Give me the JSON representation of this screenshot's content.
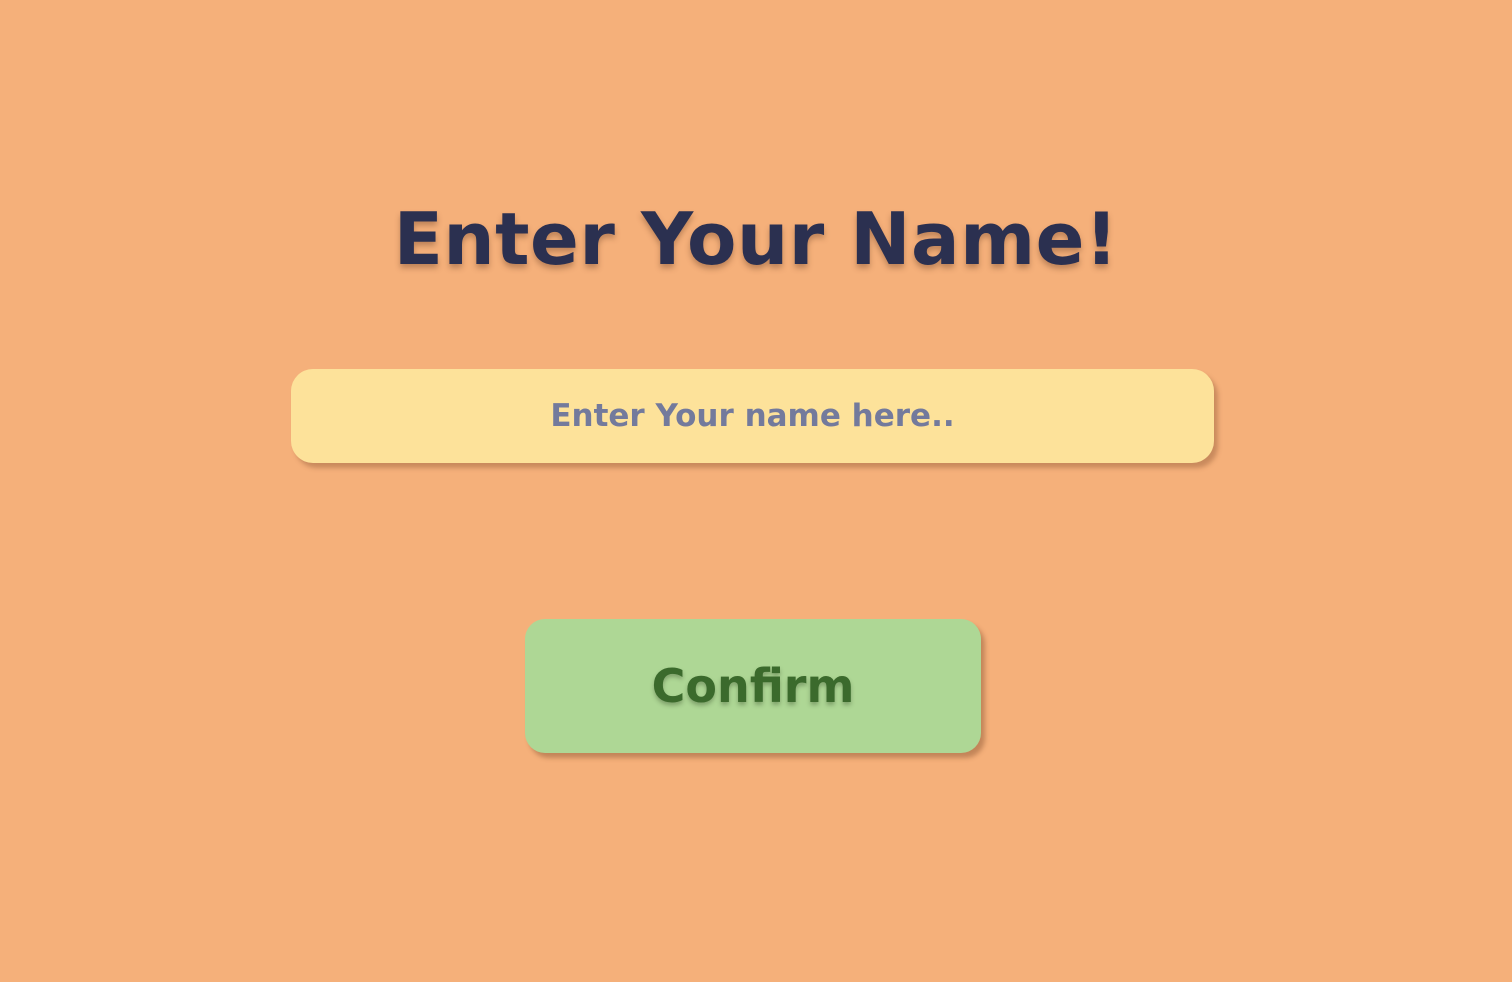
{
  "page": {
    "title": "Enter Your Name!"
  },
  "name_input": {
    "value": "",
    "placeholder": "Enter Your name here.."
  },
  "confirm_button": {
    "label": "Confirm"
  },
  "colors": {
    "background": "#f5b07a",
    "title_text": "#2b3050",
    "input_background": "#fde29a",
    "placeholder_text": "#737a9c",
    "button_background": "#aed795",
    "button_text": "#3b6a2c"
  }
}
